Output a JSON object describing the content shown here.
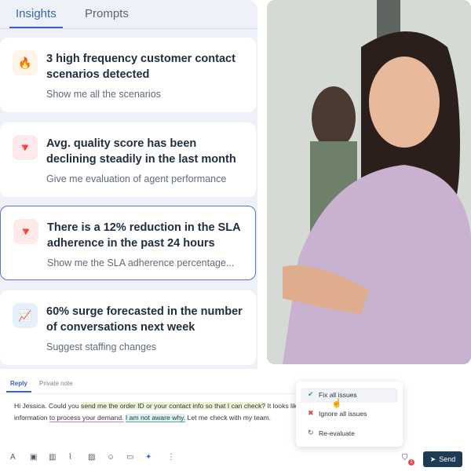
{
  "tabs": [
    {
      "label": "Insights",
      "active": true
    },
    {
      "label": "Prompts",
      "active": false
    }
  ],
  "cards": [
    {
      "icon": "fire-icon",
      "glyph": "🔥",
      "title": "3 high frequency customer contact scenarios detected",
      "prompt": "Show me all the scenarios",
      "selected": false
    },
    {
      "icon": "down-triangle-icon",
      "glyph": "🔻",
      "title": "Avg. quality score has been declining steadily in the last month",
      "prompt": "Give me evaluation of agent performance",
      "selected": false
    },
    {
      "icon": "down-triangle-icon",
      "glyph": "🔻",
      "title": "There is a 12% reduction in the SLA adherence in the past 24 hours",
      "prompt": "Show me the SLA adherence percentage...",
      "selected": true
    },
    {
      "icon": "chart-increasing-icon",
      "glyph": "📈",
      "title": "60% surge forecasted in the number of conversations next week",
      "prompt": "Suggest staffing changes",
      "selected": false
    }
  ],
  "composer": {
    "tabs": [
      "Reply",
      "Private note"
    ],
    "text": {
      "a": "Hi Jessica. Could you ",
      "b": "send me the order ID or your contact info so that I can check?",
      "c": " It looks like we need more",
      "d": "information ",
      "e": "to process your demand.",
      "f": " ",
      "g": "I am not aware why.",
      "h": " Let me check with my team."
    },
    "send_label": "Send",
    "badge_count": "1"
  },
  "popup": {
    "items": [
      {
        "icon": "check-icon",
        "label": "Fix all issues"
      },
      {
        "icon": "x-icon",
        "label": "Ignore all issues"
      },
      {
        "icon": "refresh-icon",
        "label": "Re-evaluate"
      }
    ]
  }
}
